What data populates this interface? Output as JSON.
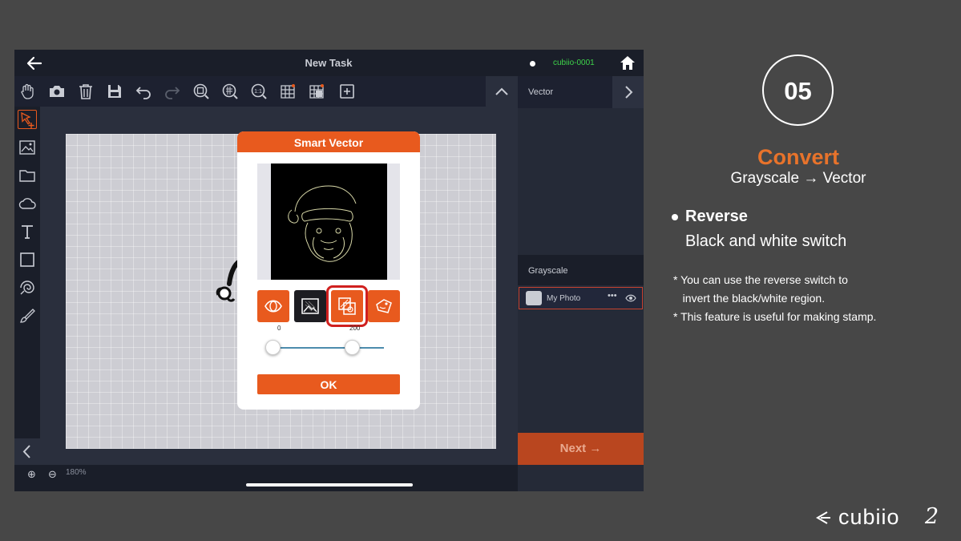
{
  "app": {
    "task_title": "New Task",
    "device_name": "cubiio-0001",
    "zoom_level": "180%"
  },
  "toolbar": {
    "tools": [
      "hand-icon",
      "camera-icon",
      "trash-icon",
      "save-icon",
      "undo-icon",
      "redo-icon",
      "fit-screen-icon",
      "grid-zoom-icon",
      "actual-size-icon",
      "grid-icon",
      "grid-settings-icon",
      "add-icon"
    ]
  },
  "sidebar": {
    "tools": [
      "select-icon",
      "image-icon",
      "folder-icon",
      "cloud-icon",
      "text-icon",
      "rectangle-icon",
      "spiral-icon",
      "brush-icon"
    ]
  },
  "right_panel": {
    "vector_label": "Vector",
    "grayscale_label": "Grayscale",
    "layer_name": "My Photo",
    "layer_more": "•••",
    "next_label": "Next →"
  },
  "dialog": {
    "title": "Smart Vector",
    "slider_min": "0",
    "slider_max": "200",
    "slider_low_value": 0,
    "slider_high_value": 200,
    "ok_label": "OK",
    "selected_mode": "reverse"
  },
  "info": {
    "step_number": "05",
    "title": "Convert",
    "subtitle": "Grayscale → Vector",
    "bullet_title": "Reverse",
    "bullet_desc": "Black and white switch",
    "notes": [
      "* You can use the reverse switch to",
      "   invert the black/white region.",
      "* This feature is useful for making stamp."
    ],
    "brand": "cubiio",
    "brand_version": "2"
  },
  "colors": {
    "accent": "#e85a1e",
    "title_orange": "#e8732b",
    "device_green": "#3ed34a",
    "highlight_red": "#d0201f"
  }
}
